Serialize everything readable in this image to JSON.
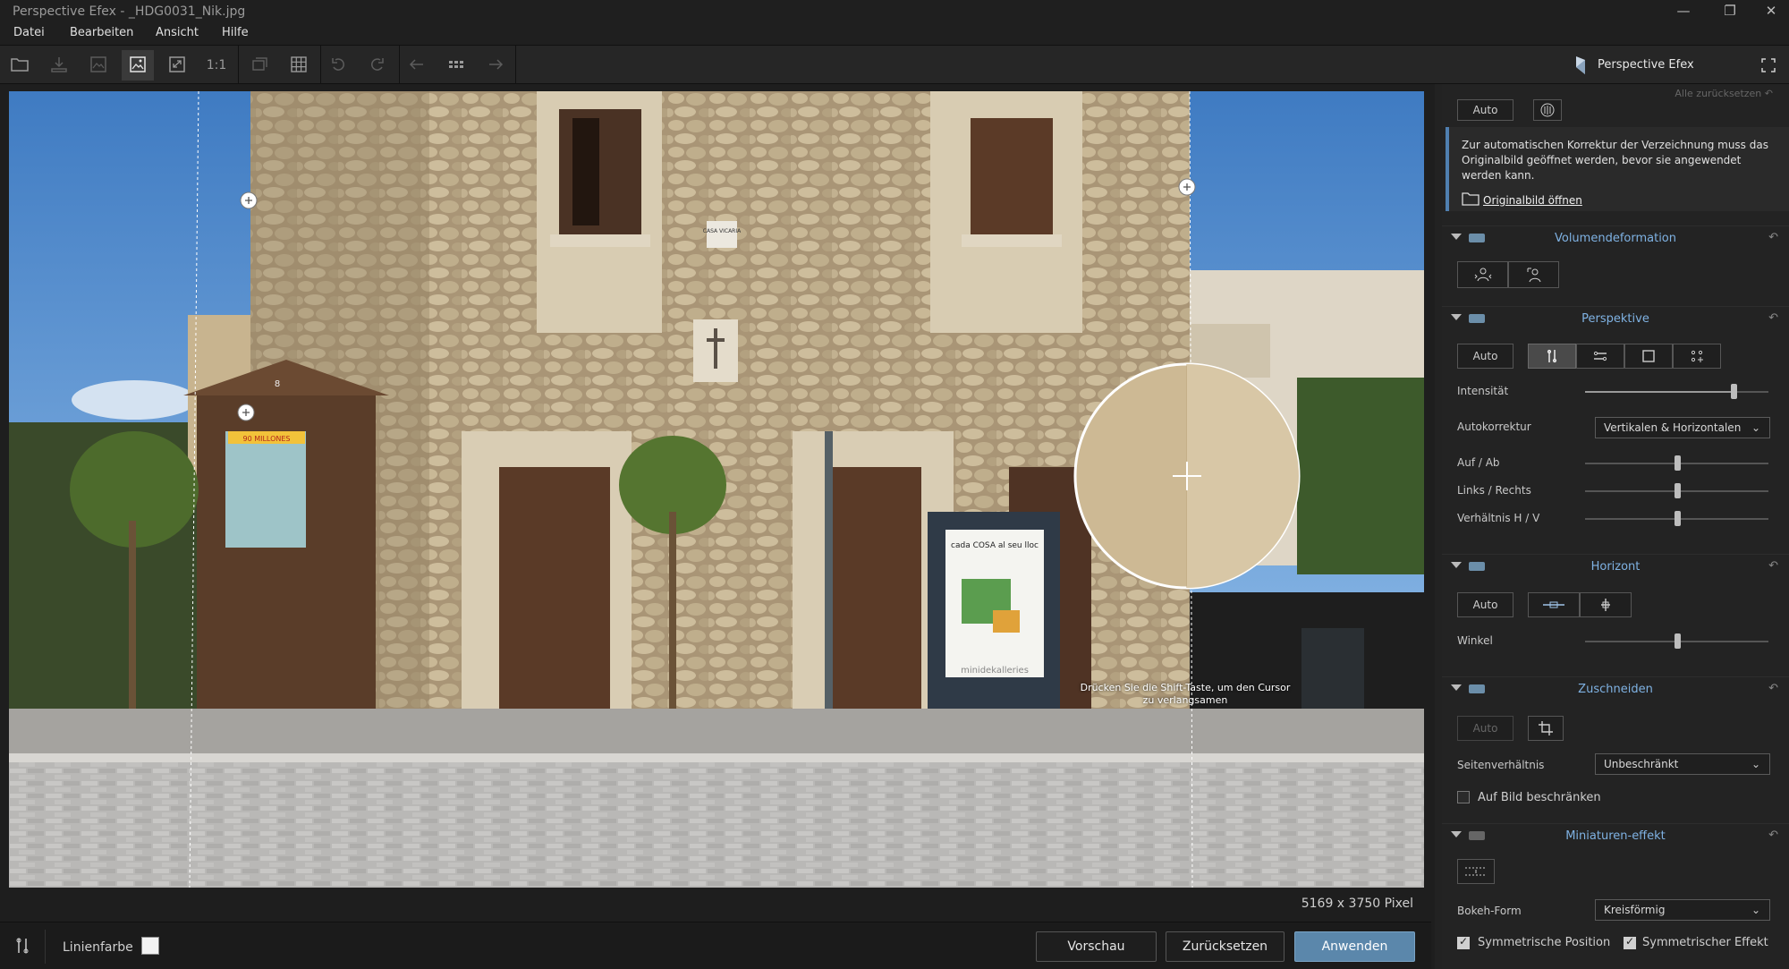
{
  "window": {
    "title": "Perspective Efex - _HDG0031_Nik.jpg",
    "minimize": "—",
    "maximize": "❐",
    "close": "✕"
  },
  "menu": [
    "Datei",
    "Bearbeiten",
    "Ansicht",
    "Hilfe"
  ],
  "toolbar": {
    "zoom_1to1": "1:1",
    "brand": "Perspective Efex"
  },
  "canvas": {
    "pixel_size": "5169 x 3750 Pixel",
    "loupe_hint": "Drücken Sie die Shift-Taste, um den Cursor zu verlangsamen",
    "sign_text": "CASA VICARIA",
    "kiosk_text": "90 MILLONES",
    "kiosk_number": "8",
    "poster_text_top": "cada COSA al seu lloc",
    "poster_text_bottom": "minidekalleries"
  },
  "panel": {
    "reset_all": "Alle zurücksetzen",
    "reset_symbol": "↶",
    "top": {
      "auto": "Auto",
      "info": "Zur automatischen Korrektur der Verzeichnung muss das Originalbild geöffnet werden, bevor sie angewendet werden kann.",
      "open_original": "Originalbild öffnen"
    },
    "volume": {
      "name": "Volumendeformation"
    },
    "perspective": {
      "name": "Perspektive",
      "auto": "Auto",
      "intensity_label": "Intensität",
      "intensity": 0.81,
      "autocorrect_label": "Autokorrektur",
      "autocorrect_value": "Vertikalen & Horizontalen",
      "updown_label": "Auf / Ab",
      "updown": 0.5,
      "leftright_label": "Links / Rechts",
      "leftright": 0.5,
      "ratio_label": "Verhältnis H / V",
      "ratio": 0.5
    },
    "horizon": {
      "name": "Horizont",
      "auto": "Auto",
      "angle_label": "Winkel",
      "angle": 0.5
    },
    "crop": {
      "name": "Zuschneiden",
      "auto": "Auto",
      "aspect_label": "Seitenverhältnis",
      "aspect_value": "Unbeschränkt",
      "limit_label": "Auf Bild beschränken",
      "limit_checked": false
    },
    "miniature": {
      "name": "Miniaturen-effekt",
      "bokeh_label": "Bokeh-Form",
      "bokeh_value": "Kreisförmig",
      "sym_pos_label": "Symmetrische Position",
      "sym_pos_checked": true,
      "sym_eff_label": "Symmetrischer Effekt",
      "sym_eff_checked": true
    }
  },
  "bottom": {
    "line_color_label": "Linienfarbe",
    "line_color": "#f2f2f2",
    "preview": "Vorschau",
    "reset": "Zurücksetzen",
    "apply": "Anwenden"
  },
  "colors": {
    "accent_blue": "#7fb2e3",
    "apply_button": "#5b87ab",
    "sky": "#4d86c8",
    "stone": "#b8a68a"
  }
}
